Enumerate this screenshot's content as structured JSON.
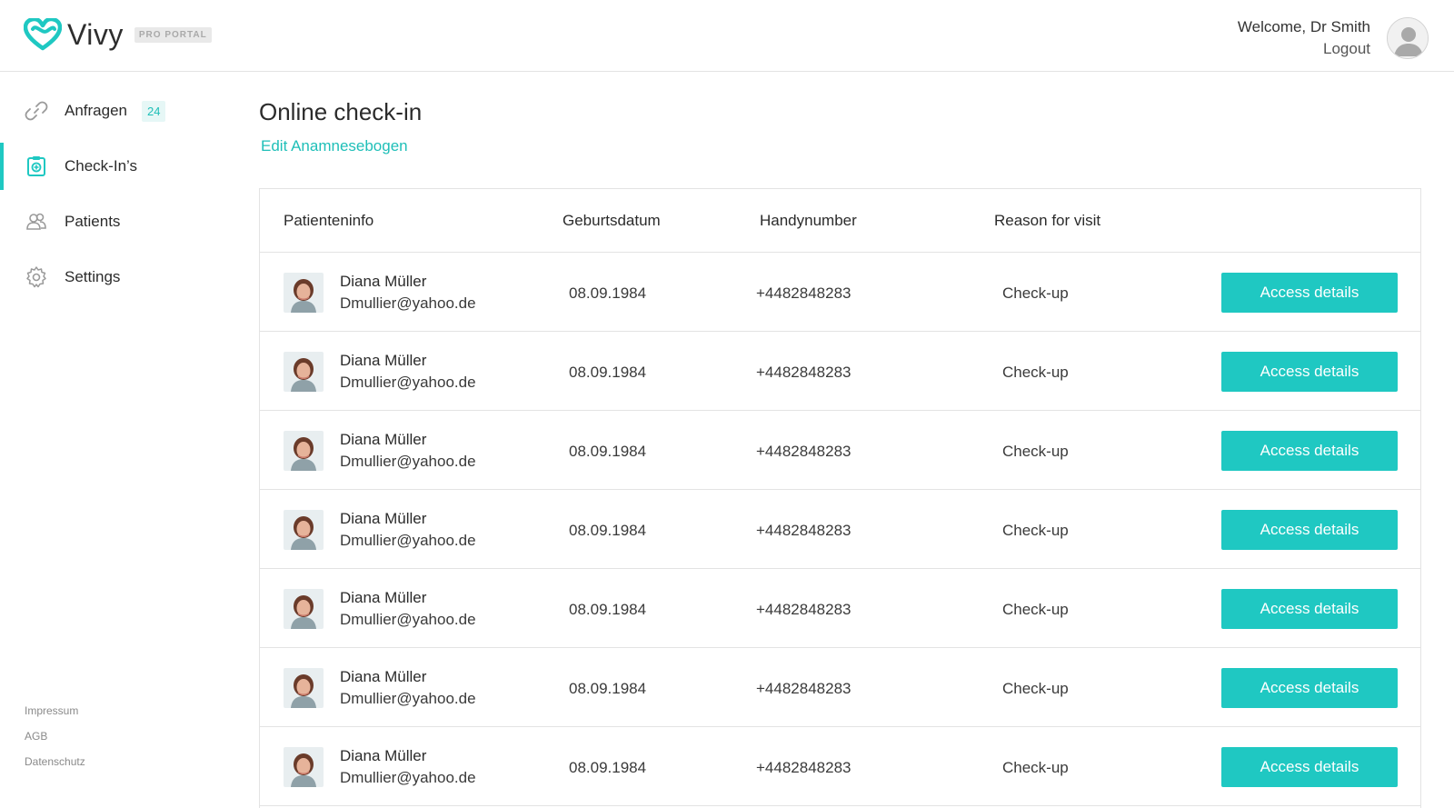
{
  "header": {
    "brand": "Vivy",
    "brand_badge": "PRO PORTAL",
    "welcome": "Welcome, Dr Smith",
    "logout": "Logout"
  },
  "sidebar": {
    "items": [
      {
        "label": "Anfragen",
        "badge": "24",
        "icon": "link-icon"
      },
      {
        "label": "Check-In’s",
        "icon": "clipboard-icon"
      },
      {
        "label": "Patients",
        "icon": "patients-icon"
      },
      {
        "label": "Settings",
        "icon": "gear-icon"
      }
    ],
    "active": "Check-In’s",
    "footer": [
      "Impressum",
      "AGB",
      "Datenschutz"
    ]
  },
  "main": {
    "title": "Online check-in",
    "edit_link": "Edit Anamnesebogen",
    "table": {
      "headers": [
        "Patienteninfo",
        "Geburtsdatum",
        "Handynumber",
        "Reason for visit"
      ],
      "action_label": "Access details",
      "rows": [
        {
          "name": "Diana Müller",
          "email": "Dmullier@yahoo.de",
          "dob": "08.09.1984",
          "phone": "+4482848283",
          "reason": "Check-up"
        },
        {
          "name": "Diana Müller",
          "email": "Dmullier@yahoo.de",
          "dob": "08.09.1984",
          "phone": "+4482848283",
          "reason": "Check-up"
        },
        {
          "name": "Diana Müller",
          "email": "Dmullier@yahoo.de",
          "dob": "08.09.1984",
          "phone": "+4482848283",
          "reason": "Check-up"
        },
        {
          "name": "Diana Müller",
          "email": "Dmullier@yahoo.de",
          "dob": "08.09.1984",
          "phone": "+4482848283",
          "reason": "Check-up"
        },
        {
          "name": "Diana Müller",
          "email": "Dmullier@yahoo.de",
          "dob": "08.09.1984",
          "phone": "+4482848283",
          "reason": "Check-up"
        },
        {
          "name": "Diana Müller",
          "email": "Dmullier@yahoo.de",
          "dob": "08.09.1984",
          "phone": "+4482848283",
          "reason": "Check-up"
        },
        {
          "name": "Diana Müller",
          "email": "Dmullier@yahoo.de",
          "dob": "08.09.1984",
          "phone": "+4482848283",
          "reason": "Check-up"
        }
      ]
    }
  },
  "colors": {
    "accent": "#1fc8c2",
    "accent_text": "#1fbfb8",
    "border": "#e3e3e3"
  }
}
